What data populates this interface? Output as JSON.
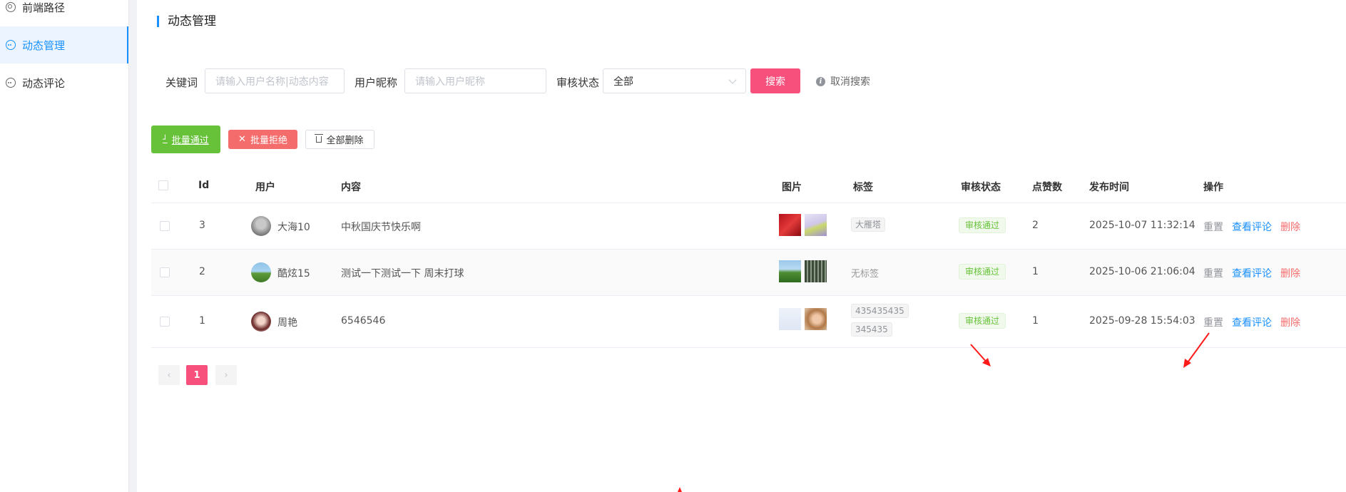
{
  "sidebar": {
    "items": [
      {
        "label": "前端路径",
        "icon": "target-icon"
      },
      {
        "label": "动态管理",
        "icon": "chat-icon",
        "active": true
      },
      {
        "label": "动态评论",
        "icon": "chat-icon"
      }
    ]
  },
  "page": {
    "title": "动态管理"
  },
  "filters": {
    "keyword_label": "关键词",
    "keyword_placeholder": "请输入用户名称|动态内容",
    "nickname_label": "用户昵称",
    "nickname_placeholder": "请输入用户昵称",
    "status_label": "审核状态",
    "status_value": "全部",
    "search_label": "搜索",
    "cancel_label": "取消搜索"
  },
  "toolbar": {
    "approve_label": "批量通过",
    "reject_label": "批量拒绝",
    "delete_all_label": "全部删除"
  },
  "table": {
    "headers": {
      "id": "Id",
      "user": "用户",
      "content": "内容",
      "images": "图片",
      "tags": "标签",
      "status": "审核状态",
      "likes": "点赞数",
      "time": "发布时间",
      "actions": "操作"
    },
    "rows": [
      {
        "id": "3",
        "user": "大海10",
        "content": "中秋国庆节快乐啊",
        "tags": [
          "大雁塔"
        ],
        "status": "审核通过",
        "likes": "2",
        "time": "2025-10-07 11:32:14"
      },
      {
        "id": "2",
        "user": "酷炫15",
        "content": "测试一下测试一下 周末打球",
        "tags": [],
        "no_tag": "无标签",
        "status": "审核通过",
        "likes": "1",
        "time": "2025-10-06 21:06:04"
      },
      {
        "id": "1",
        "user": "周艳",
        "content": "6546546",
        "tags": [
          "435435435",
          "345435"
        ],
        "status": "审核通过",
        "likes": "1",
        "time": "2025-09-28 15:54:03"
      }
    ],
    "actions": {
      "reset": "重置",
      "view": "查看评论",
      "delete": "删除"
    }
  },
  "pagination": {
    "current": "1",
    "prev_icon": "chevron-left-icon",
    "next_icon": "chevron-right-icon"
  },
  "colors": {
    "primary": "#1890ff",
    "search": "#f7507c",
    "approve": "#67c23a",
    "reject": "#f56c6c",
    "annotation_arrow": "#ff1a1a"
  }
}
